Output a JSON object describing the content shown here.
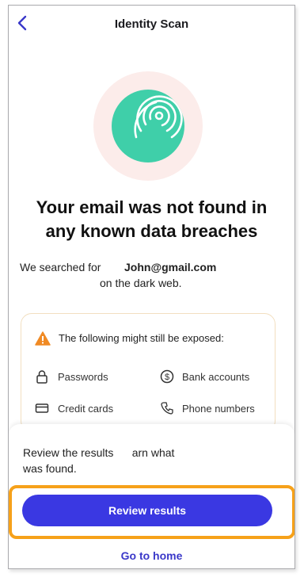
{
  "header": {
    "title": "Identity Scan",
    "back_icon": "chevron-left-icon"
  },
  "hero": {
    "icon": "fingerprint-icon",
    "outer_color": "#fcecea",
    "inner_color": "#3fcfa9"
  },
  "result": {
    "headline_line1": "Your email was not found in",
    "headline_line2": "any known data breaches",
    "searched_prefix": "We searched for",
    "email": "John@gmail.com",
    "searched_suffix": "on the dark web."
  },
  "exposed": {
    "title": "The following might still be exposed:",
    "warning_icon": "warning-icon",
    "items": [
      {
        "label": "Passwords",
        "icon": "lock-icon"
      },
      {
        "label": "Bank accounts",
        "icon": "dollar-icon"
      },
      {
        "label": "Credit cards",
        "icon": "credit-card-icon"
      },
      {
        "label": "Phone numbers",
        "icon": "phone-icon"
      }
    ]
  },
  "sheet": {
    "text_line1": "Review the results      arn what",
    "text_line2": "was found.",
    "primary_button": "Review results",
    "secondary_link": "Go to home"
  },
  "colors": {
    "primary": "#3a38e2",
    "highlight": "#f6a11a",
    "accent_green": "#3fcfa9",
    "warning": "#f08a24"
  }
}
